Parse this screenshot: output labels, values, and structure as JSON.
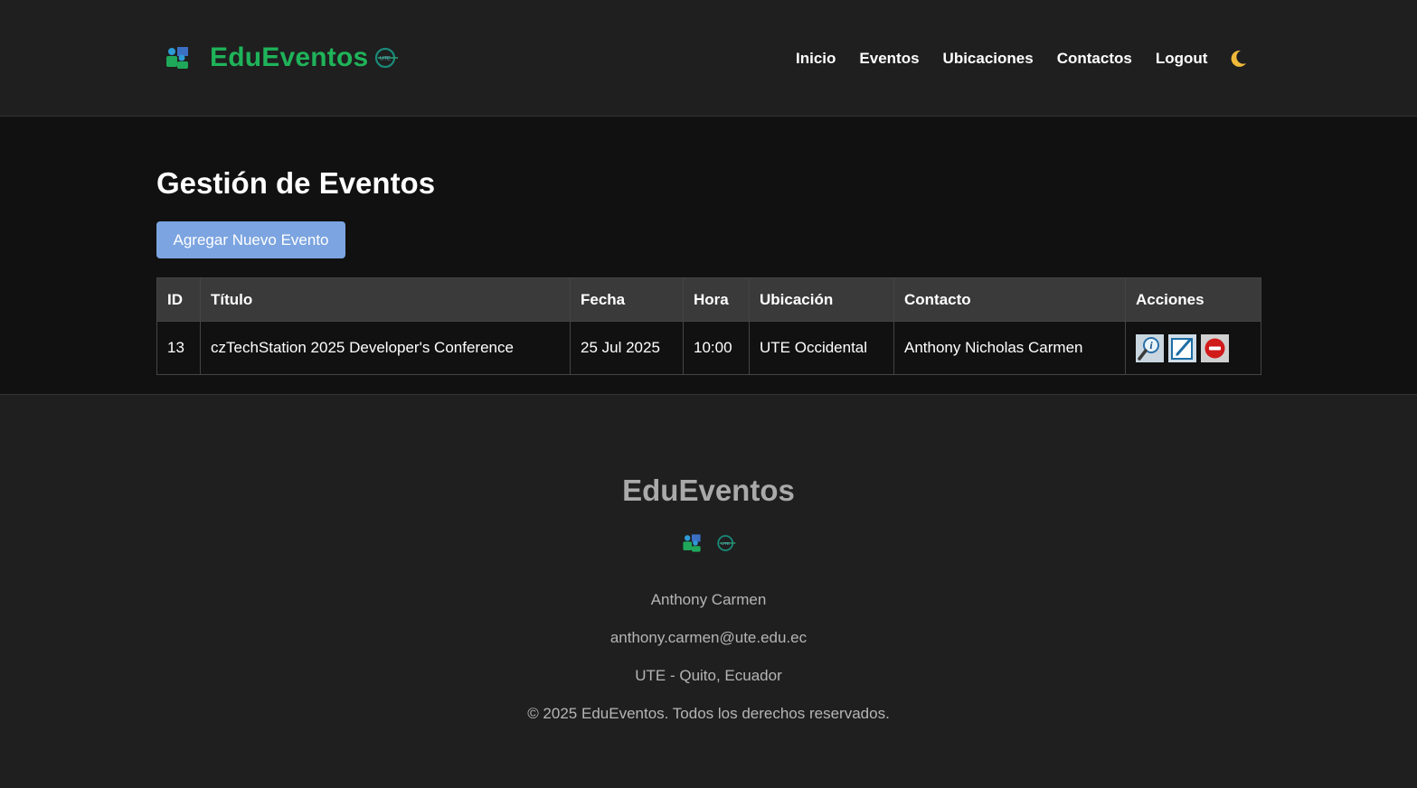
{
  "brand": {
    "name": "EduEventos"
  },
  "nav": {
    "items": [
      "Inicio",
      "Eventos",
      "Ubicaciones",
      "Contactos",
      "Logout"
    ]
  },
  "main": {
    "title": "Gestión de Eventos",
    "add_button": "Agregar Nuevo Evento",
    "table": {
      "headers": [
        "ID",
        "Título",
        "Fecha",
        "Hora",
        "Ubicación",
        "Contacto",
        "Acciones"
      ],
      "rows": [
        {
          "id": "13",
          "titulo": "czTechStation 2025 Developer's Conference",
          "fecha": "25 Jul 2025",
          "hora": "10:00",
          "ubicacion": "UTE Occidental",
          "contacto": "Anthony Nicholas Carmen"
        }
      ]
    }
  },
  "footer": {
    "title": "EduEventos",
    "author": "Anthony Carmen",
    "email": "anthony.carmen@ute.edu.ec",
    "location": "UTE - Quito, Ecuador",
    "copyright": "© 2025 EduEventos. Todos los derechos reservados."
  },
  "icons": {
    "logo": "people-board-icon",
    "ute": "ute-globe-icon",
    "theme": "moon-icon",
    "view": "info-magnifier-icon",
    "edit": "edit-icon",
    "delete": "delete-icon"
  },
  "colors": {
    "brand": "#1fb35a",
    "button": "#7ba4e0",
    "header_bg": "#1f1f1f",
    "page_bg": "#111111"
  }
}
